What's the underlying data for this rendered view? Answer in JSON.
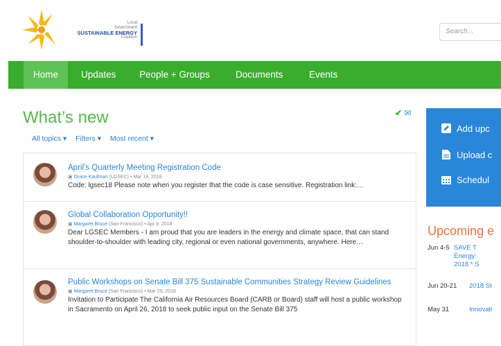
{
  "header": {
    "logo": {
      "line1": "Local",
      "line2": "Government",
      "line3": "SUSTAINABLE ENERGY",
      "line4": "Coalition"
    },
    "search_placeholder": "Search..."
  },
  "nav": {
    "items": [
      "Home",
      "Updates",
      "People + Groups",
      "Documents",
      "Events"
    ],
    "active": "Home"
  },
  "main": {
    "title": "What’s new",
    "filters": [
      "All topics ▾",
      "Filters ▾",
      "Most recent ▾"
    ],
    "feed": [
      {
        "title": "April's Quarterly Meeting Registration Code",
        "author": "Grace Kaufman",
        "org": "(LGSEC)",
        "date": "• Mar 14, 2018",
        "text": "Code: lgsec18 Please note when you register that the code is case sensitive. Registration link:…"
      },
      {
        "title": "Global Collaboration Opportunity!!",
        "author": "Margaret Bruce",
        "org": "(San Francisco)",
        "date": "• Apr 9, 2018",
        "text": "Dear LGSEC Members - I am proud that you are leaders in the energy and climate space, that can stand shoulder-to-shoulder with leading city, regional or even national governments, anywhere. Here…"
      },
      {
        "title": "Public Workshops on Senate Bill 375 Sustainable Communities Strategy Review Guidelines",
        "author": "Margaret Bruce",
        "org": "(San Francisco)",
        "date": "• Mar 29, 2018",
        "text": "Invitation to Participate The California Air Resources Board (CARB or Board) staff will host a public workshop in Sacramento on April 26, 2018 to seek public input on the Senate Bill 375"
      }
    ]
  },
  "sidebar": {
    "actions": [
      "Add upc",
      "Upload c",
      "Schedul"
    ],
    "upcoming_title": "Upcoming e",
    "events": [
      {
        "date": "Jun 4-5",
        "title_lines": [
          "SAVE T",
          "Energy:",
          "2018 * S"
        ]
      },
      {
        "date": "Jun 20-21",
        "title_lines": [
          "2018 St"
        ]
      },
      {
        "date": "May 31",
        "title_lines": [
          "Innovati"
        ]
      }
    ]
  }
}
